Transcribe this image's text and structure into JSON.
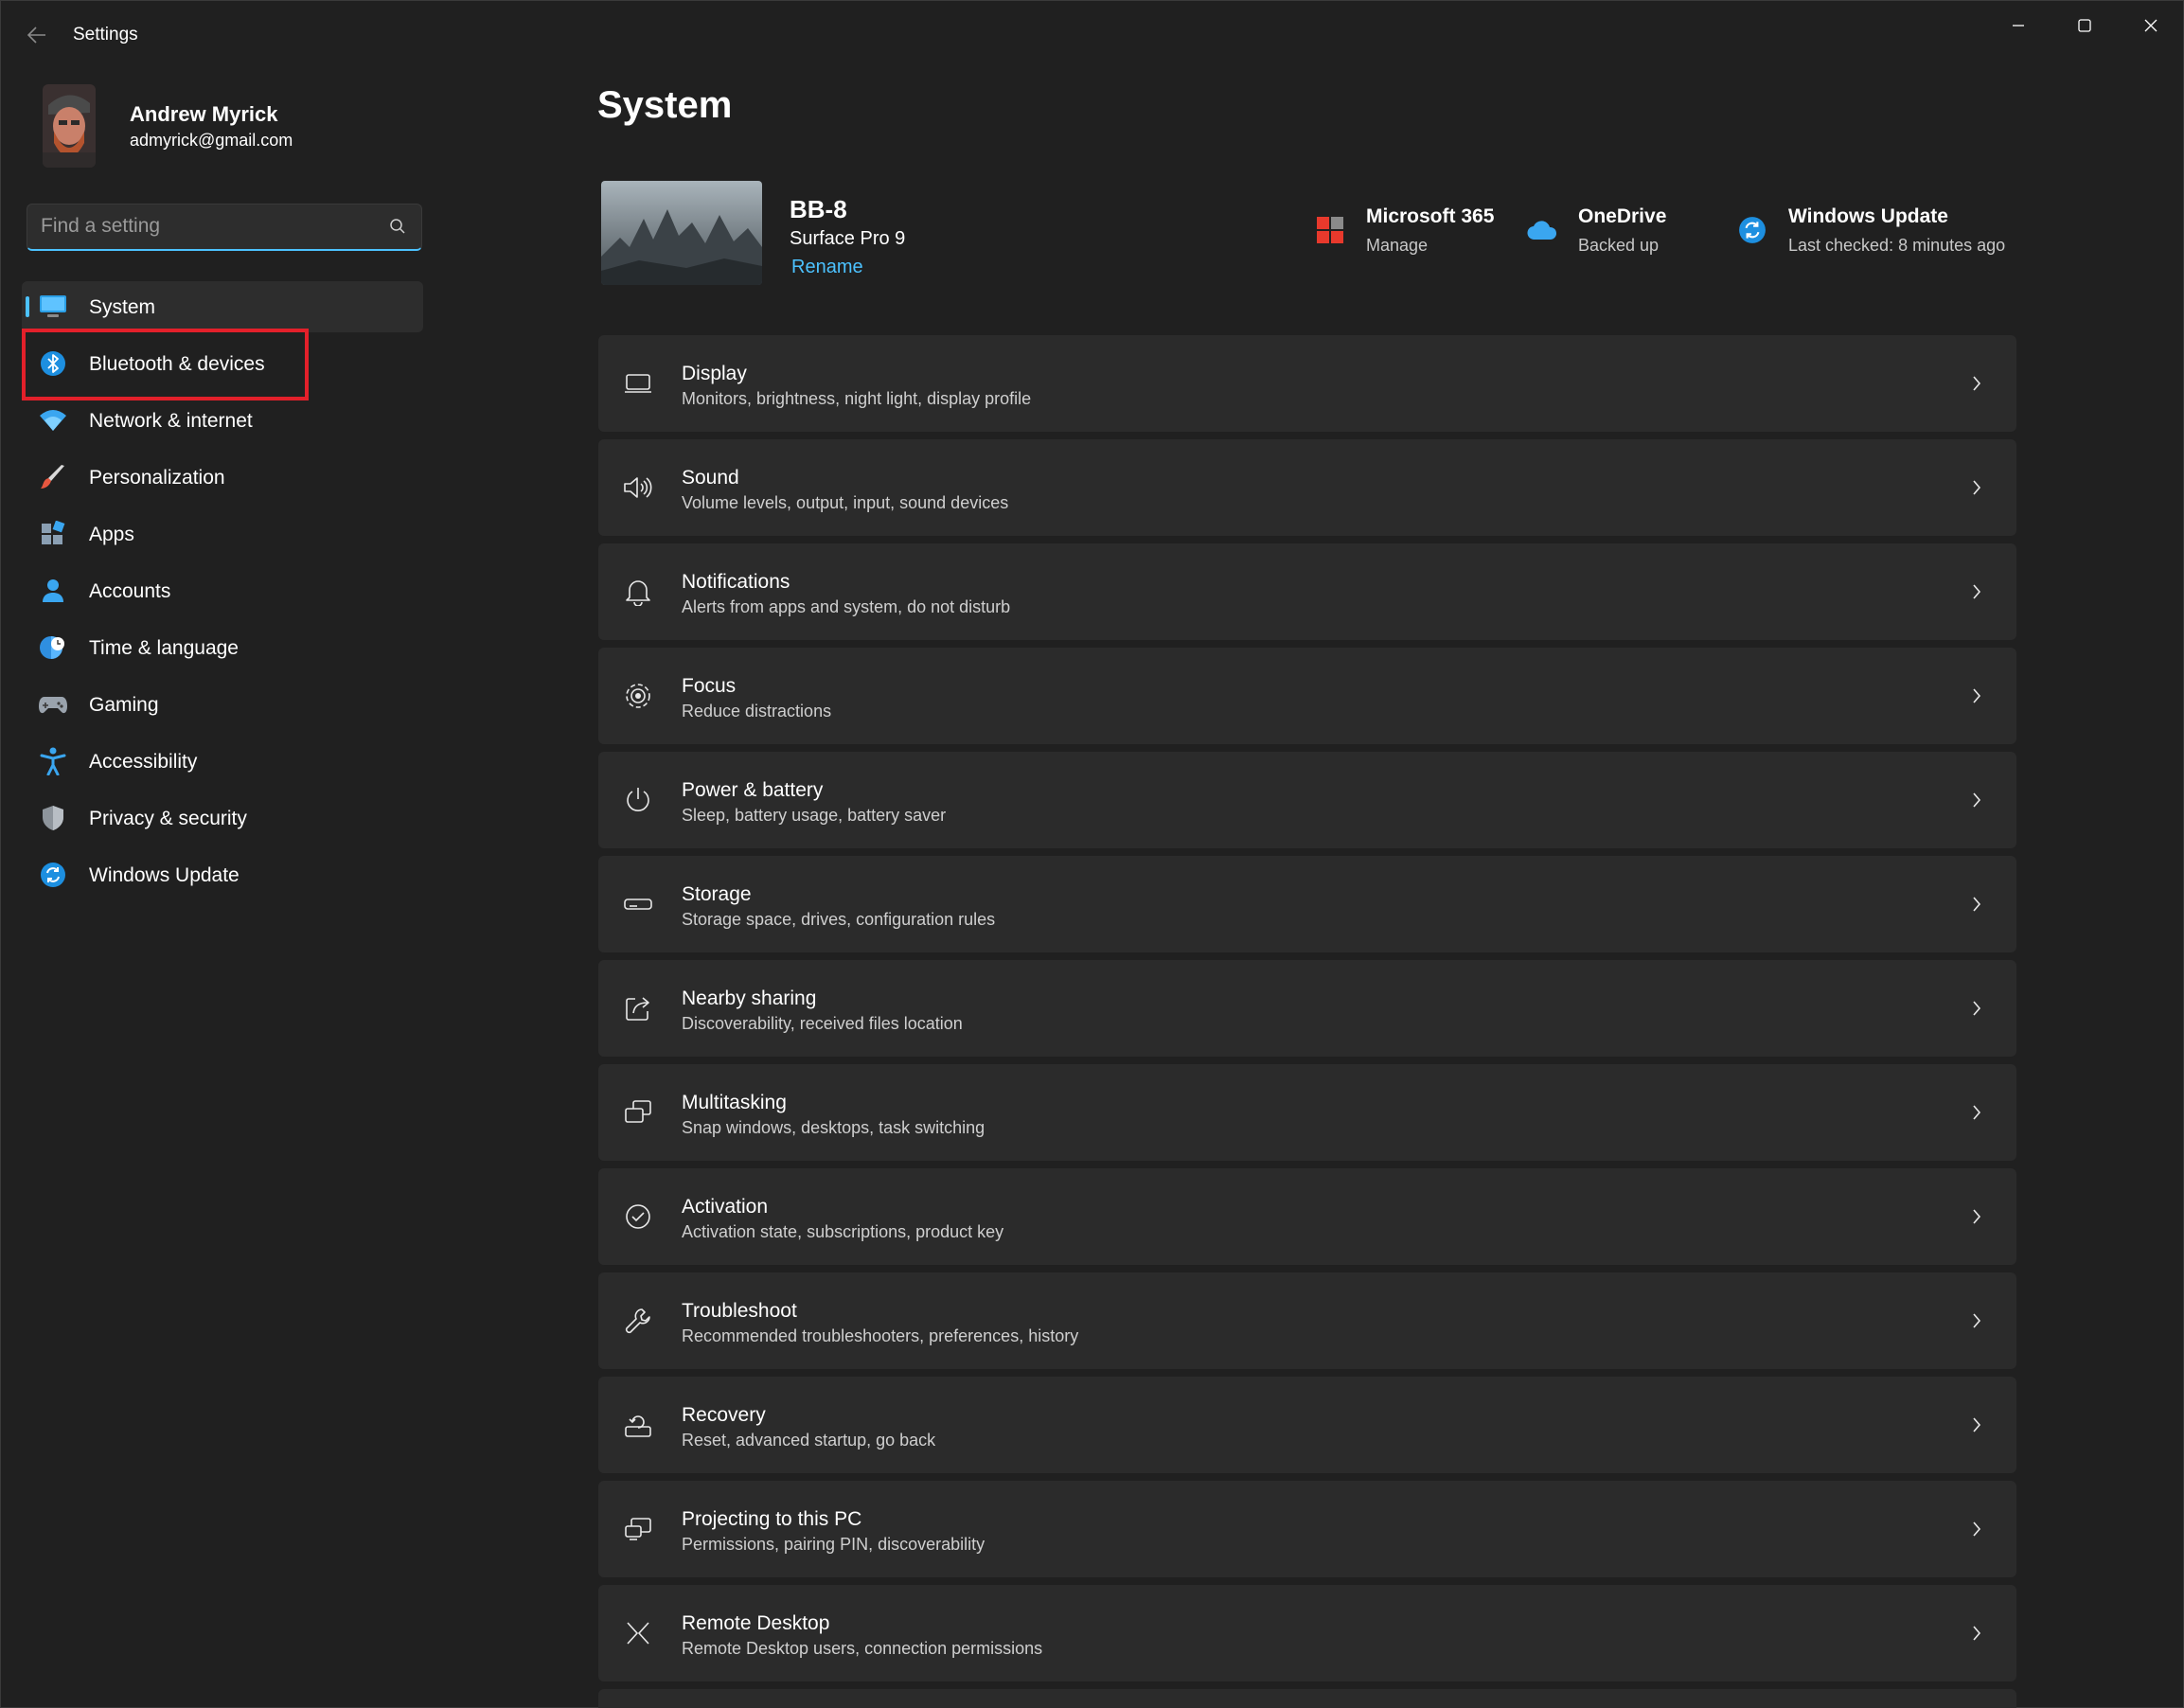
{
  "window": {
    "title": "Settings"
  },
  "profile": {
    "name": "Andrew Myrick",
    "email": "admyrick@gmail.com"
  },
  "search": {
    "placeholder": "Find a setting",
    "value": ""
  },
  "sidebar": {
    "active_index": 0,
    "highlighted_index": 1,
    "items": [
      {
        "label": "System",
        "icon": "monitor-icon"
      },
      {
        "label": "Bluetooth & devices",
        "icon": "bluetooth-icon"
      },
      {
        "label": "Network & internet",
        "icon": "wifi-icon"
      },
      {
        "label": "Personalization",
        "icon": "paintbrush-icon"
      },
      {
        "label": "Apps",
        "icon": "apps-icon"
      },
      {
        "label": "Accounts",
        "icon": "person-icon"
      },
      {
        "label": "Time & language",
        "icon": "clock-globe-icon"
      },
      {
        "label": "Gaming",
        "icon": "gamepad-icon"
      },
      {
        "label": "Accessibility",
        "icon": "accessibility-icon"
      },
      {
        "label": "Privacy & security",
        "icon": "shield-icon"
      },
      {
        "label": "Windows Update",
        "icon": "update-icon"
      }
    ]
  },
  "main": {
    "title": "System",
    "device": {
      "name": "BB-8",
      "model": "Surface Pro 9",
      "rename": "Rename"
    },
    "tiles": [
      {
        "title": "Microsoft 365",
        "subtitle": "Manage",
        "icon": "microsoft-365-icon"
      },
      {
        "title": "OneDrive",
        "subtitle": "Backed up",
        "icon": "cloud-icon"
      },
      {
        "title": "Windows Update",
        "subtitle": "Last checked: 8 minutes ago",
        "icon": "update-icon"
      }
    ],
    "cards": [
      {
        "title": "Display",
        "subtitle": "Monitors, brightness, night light, display profile",
        "icon": "display-icon"
      },
      {
        "title": "Sound",
        "subtitle": "Volume levels, output, input, sound devices",
        "icon": "speaker-icon"
      },
      {
        "title": "Notifications",
        "subtitle": "Alerts from apps and system, do not disturb",
        "icon": "bell-icon"
      },
      {
        "title": "Focus",
        "subtitle": "Reduce distractions",
        "icon": "focus-icon"
      },
      {
        "title": "Power & battery",
        "subtitle": "Sleep, battery usage, battery saver",
        "icon": "power-icon"
      },
      {
        "title": "Storage",
        "subtitle": "Storage space, drives, configuration rules",
        "icon": "storage-icon"
      },
      {
        "title": "Nearby sharing",
        "subtitle": "Discoverability, received files location",
        "icon": "share-icon"
      },
      {
        "title": "Multitasking",
        "subtitle": "Snap windows, desktops, task switching",
        "icon": "multitasking-icon"
      },
      {
        "title": "Activation",
        "subtitle": "Activation state, subscriptions, product key",
        "icon": "checkmark-circle-icon"
      },
      {
        "title": "Troubleshoot",
        "subtitle": "Recommended troubleshooters, preferences, history",
        "icon": "wrench-icon"
      },
      {
        "title": "Recovery",
        "subtitle": "Reset, advanced startup, go back",
        "icon": "recovery-icon"
      },
      {
        "title": "Projecting to this PC",
        "subtitle": "Permissions, pairing PIN, discoverability",
        "icon": "projecting-icon"
      },
      {
        "title": "Remote Desktop",
        "subtitle": "Remote Desktop users, connection permissions",
        "icon": "remote-desktop-icon"
      }
    ]
  },
  "colors": {
    "background": "#202020",
    "card": "#2b2b2b",
    "accent": "#4cc2ff",
    "highlight": "#e3202a"
  }
}
